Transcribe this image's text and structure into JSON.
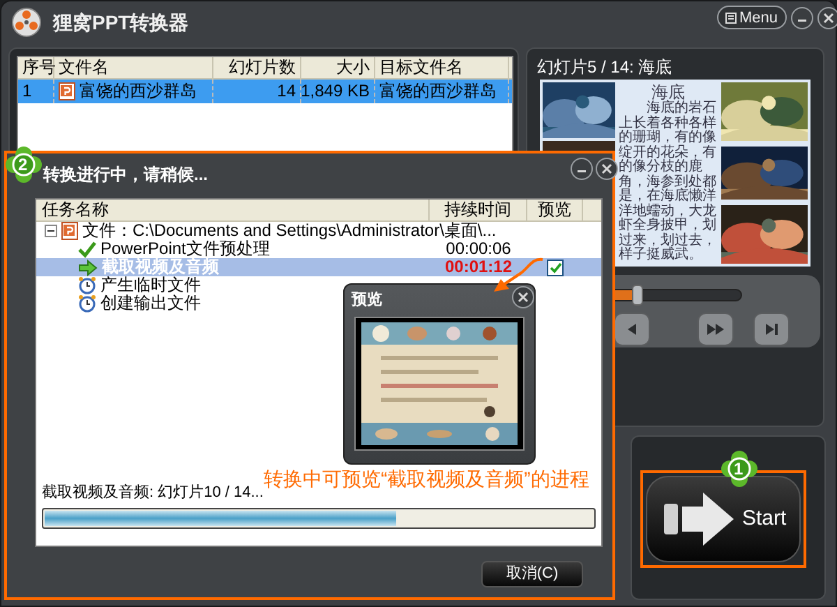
{
  "window": {
    "title": "狸窝PPT转换器",
    "menu_button": "Menu"
  },
  "file_table": {
    "columns": [
      "序号",
      "文件名",
      "幻灯片数",
      "大小",
      "目标文件名"
    ],
    "rows": [
      {
        "cells": [
          "1",
          "富饶的西沙群岛",
          "14",
          "1,849 KB",
          "富饶的西沙群岛"
        ],
        "selected": true
      }
    ]
  },
  "slide_preview": {
    "caption": "幻灯片5 / 14: 海底",
    "slide": {
      "title": "海底",
      "text": "海底的岩石上长着各种各样的珊瑚，有的像绽开的花朵，有的像分枝的鹿角，海参到处都是，在海底懒洋洋地蠕动，大龙虾全身披甲，划过来，划过去，样子挺威武。"
    },
    "seek": {
      "level": 0.47
    }
  },
  "start_button": {
    "label": "Start",
    "badge": "1"
  },
  "progress_dialog": {
    "title": "转换进行中，请稍候...",
    "badge": "2",
    "columns": [
      "任务名称",
      "持续时间",
      "预览"
    ],
    "tasks": [
      {
        "name": "文件：C:\\Documents and Settings\\Administrator\\桌面\\...",
        "expanded": true,
        "selected": false,
        "children": [
          {
            "name": "PowerPoint文件预处理",
            "kind": "done",
            "duration": "00:00:06",
            "selected": false
          },
          {
            "name": "截取视频及音频",
            "kind": "running",
            "duration": "00:01:12",
            "selected": true,
            "preview_checked": true
          },
          {
            "name": "产生临时文件",
            "kind": "pending",
            "selected": false
          },
          {
            "name": "创建输出文件",
            "kind": "pending",
            "selected": false
          }
        ]
      }
    ],
    "status_text": "截取视频及音频: 幻灯片10 / 14...",
    "progress": {
      "level": 0.64
    },
    "cancel_button": "取消(C)"
  },
  "preview_window": {
    "title": "预览"
  },
  "callout": "转换中可预览“截取视频及音频”的进程"
}
